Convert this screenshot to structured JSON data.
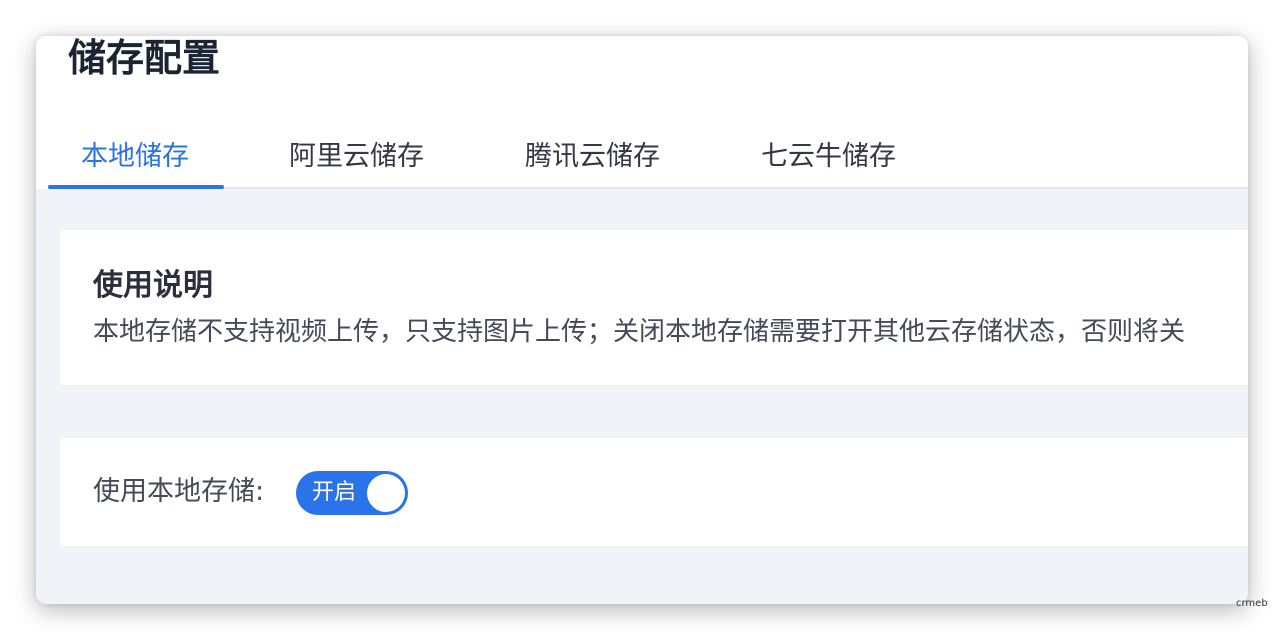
{
  "page": {
    "title": "储存配置"
  },
  "tabs": [
    {
      "label": "本地储存",
      "active": true
    },
    {
      "label": "阿里云储存",
      "active": false
    },
    {
      "label": "腾讯云储存",
      "active": false
    },
    {
      "label": "七云牛储存",
      "active": false
    }
  ],
  "instructions": {
    "title": "使用说明",
    "text": "本地存储不支持视频上传，只支持图片上传；关闭本地存储需要打开其他云存储状态，否则将关"
  },
  "setting": {
    "label": "使用本地存储:",
    "switch_text": "开启",
    "switch_on": true
  },
  "watermark": "crmeb",
  "colors": {
    "accent": "#2a73e8",
    "background": "#f0f3f7"
  }
}
